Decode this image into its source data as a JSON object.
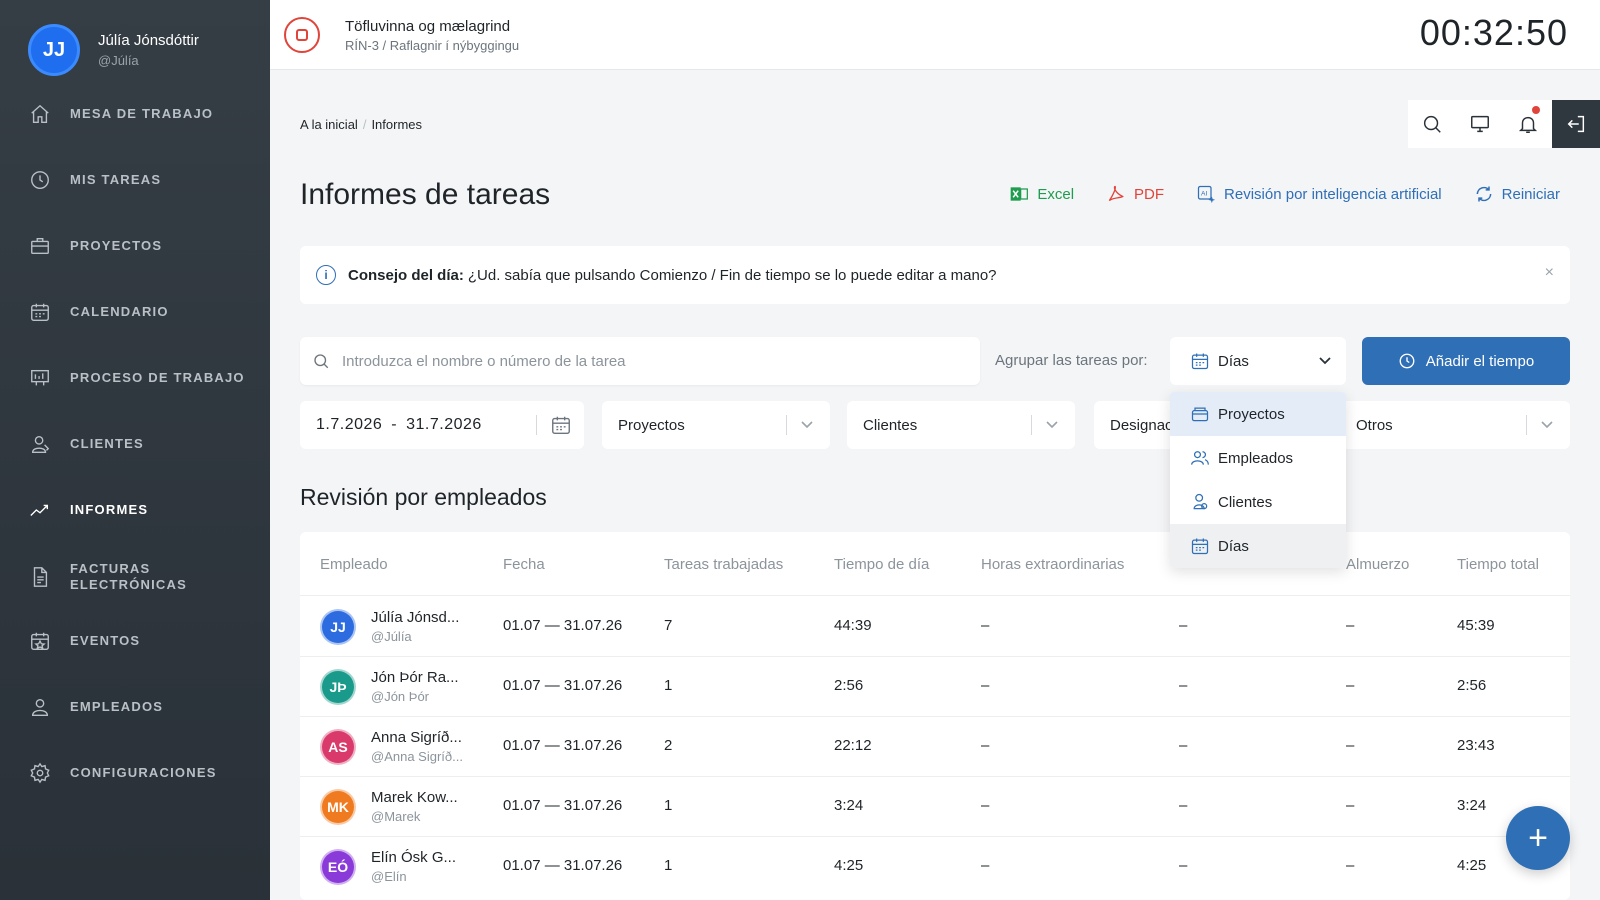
{
  "user": {
    "initials": "JJ",
    "name": "Júlía Jónsdóttir",
    "handle": "@Júlía"
  },
  "nav": [
    {
      "label": "MESA DE TRABAJO",
      "icon": "home-icon"
    },
    {
      "label": "MIS TAREAS",
      "icon": "clock-icon"
    },
    {
      "label": "PROYECTOS",
      "icon": "briefcase-icon"
    },
    {
      "label": "CALENDARIO",
      "icon": "calendar-icon"
    },
    {
      "label": "PROCESO DE TRABAJO",
      "icon": "board-icon"
    },
    {
      "label": "CLIENTES",
      "icon": "client-icon"
    },
    {
      "label": "INFORMES",
      "icon": "chart-icon"
    },
    {
      "label1": "FACTURAS",
      "label2": "ELECTRÓNICAS",
      "icon": "invoice-icon"
    },
    {
      "label": "EVENTOS",
      "icon": "event-icon"
    },
    {
      "label": "EMPLEADOS",
      "icon": "people-icon"
    },
    {
      "label": "CONFIGURACIONES",
      "icon": "gear-icon"
    }
  ],
  "topbar": {
    "task_title": "Töfluvinna og mælagrind",
    "task_sub": "RÍN-3 / Raflagnir í nýbyggingu",
    "timer": "00:32:50"
  },
  "breadcrumb": {
    "home": "A la inicial",
    "sep": "/",
    "current": "Informes"
  },
  "page_title": "Informes de tareas",
  "actions": {
    "excel": "Excel",
    "pdf": "PDF",
    "ai": "Revisión por inteligencia artificial",
    "reset": "Reiniciar"
  },
  "tip": {
    "title": "Consejo del día:",
    "text": "¿Ud. sabía que pulsando Comienzo / Fin de tiempo se lo puede editar a mano?",
    "close": "×"
  },
  "search": {
    "placeholder": "Introduzca el nombre o número de la tarea"
  },
  "group": {
    "label": "Agrupar las tareas por:",
    "selected": "Días"
  },
  "add_time": "Añadir el tiempo",
  "filters": {
    "date_from": "1.7.2026",
    "date_sep": "-",
    "date_to": "31.7.2026",
    "projects": "Proyectos",
    "clients": "Clientes",
    "designation": "Designac",
    "others": "Otros"
  },
  "dropdown": {
    "options": [
      "Proyectos",
      "Empleados",
      "Clientes",
      "Días"
    ]
  },
  "section_title": "Revisión por empleados",
  "table": {
    "headers": [
      "Empleado",
      "Fecha",
      "Tareas trabajadas",
      "Tiempo de día",
      "Horas extraordinarias",
      "Almuerzo",
      "Tiempo total"
    ],
    "rows": [
      {
        "initials": "JJ",
        "color": "#2c6be0",
        "name": "Júlía Jónsd...",
        "handle": "@Júlía",
        "date": "01.07 — 31.07.26",
        "tasks": "7",
        "day": "44:39",
        "over": "–",
        "col6": "–",
        "lunch": "–",
        "total": "45:39"
      },
      {
        "initials": "JÞ",
        "color": "#1a9a8a",
        "name": "Jón Þór Ra...",
        "handle": "@Jón Þór",
        "date": "01.07 — 31.07.26",
        "tasks": "1",
        "day": "2:56",
        "over": "–",
        "col6": "–",
        "lunch": "–",
        "total": "2:56"
      },
      {
        "initials": "AS",
        "color": "#d93a6b",
        "name": "Anna Sigríð...",
        "handle": "@Anna Sigríð...",
        "date": "01.07 — 31.07.26",
        "tasks": "2",
        "day": "22:12",
        "over": "–",
        "col6": "–",
        "lunch": "–",
        "total": "23:43"
      },
      {
        "initials": "MK",
        "color": "#f07a1f",
        "name": "Marek Kow...",
        "handle": "@Marek",
        "date": "01.07 — 31.07.26",
        "tasks": "1",
        "day": "3:24",
        "over": "–",
        "col6": "–",
        "lunch": "–",
        "total": "3:24"
      },
      {
        "initials": "EÓ",
        "color": "#8a3ad9",
        "name": "Elín Ósk G...",
        "handle": "@Elín",
        "date": "01.07 — 31.07.26",
        "tasks": "1",
        "day": "4:25",
        "over": "–",
        "col6": "–",
        "lunch": "–",
        "total": "4:25"
      }
    ]
  },
  "fab": "+"
}
